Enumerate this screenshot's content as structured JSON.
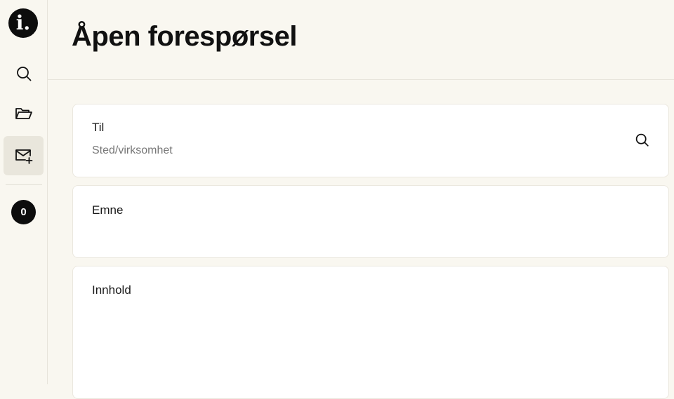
{
  "app": {
    "logo_text": "i."
  },
  "sidebar": {
    "items": [
      {
        "name": "search",
        "icon": "search-icon"
      },
      {
        "name": "folder",
        "icon": "folder-open-icon"
      },
      {
        "name": "new-request",
        "icon": "mail-plus-icon",
        "active": true
      }
    ],
    "count": "0"
  },
  "header": {
    "title": "Åpen forespørsel"
  },
  "form": {
    "to": {
      "label": "Til",
      "placeholder": "Sted/virksomhet",
      "value": ""
    },
    "subject": {
      "label": "Emne",
      "value": ""
    },
    "content": {
      "label": "Innhold",
      "value": ""
    }
  },
  "colors": {
    "background": "#f9f7f0",
    "card": "#ffffff",
    "dark": "#0d0d0d",
    "active_nav": "#e9e6dc"
  }
}
